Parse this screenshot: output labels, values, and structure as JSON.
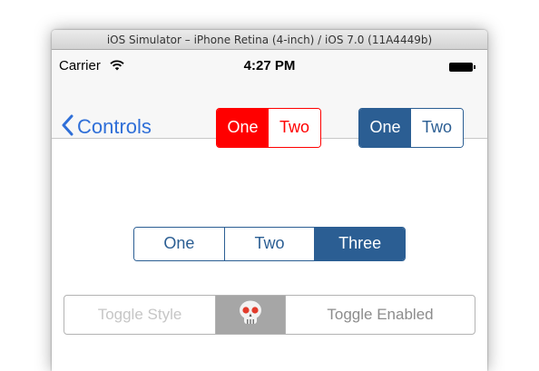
{
  "window": {
    "title": "iOS Simulator – iPhone Retina (4-inch) / iOS 7.0 (11A4449b)"
  },
  "status_bar": {
    "carrier": "Carrier",
    "time": "4:27 PM"
  },
  "nav": {
    "back_label": "Controls",
    "red_segments": [
      "One",
      "Two"
    ],
    "red_selected_index": 0,
    "blue_segments": [
      "One",
      "Two"
    ],
    "blue_selected_index": 0
  },
  "main_segmented": {
    "items": [
      "One",
      "Two",
      "Three"
    ],
    "selected_index": 2
  },
  "toggle_segmented": {
    "items": [
      "Toggle Style",
      "Toggle Enabled"
    ],
    "middle_icon": "skull-icon"
  },
  "colors": {
    "ios_blue": "#2f6fd8",
    "segment_blue": "#2b5e93",
    "segment_red": "#ff0000"
  }
}
